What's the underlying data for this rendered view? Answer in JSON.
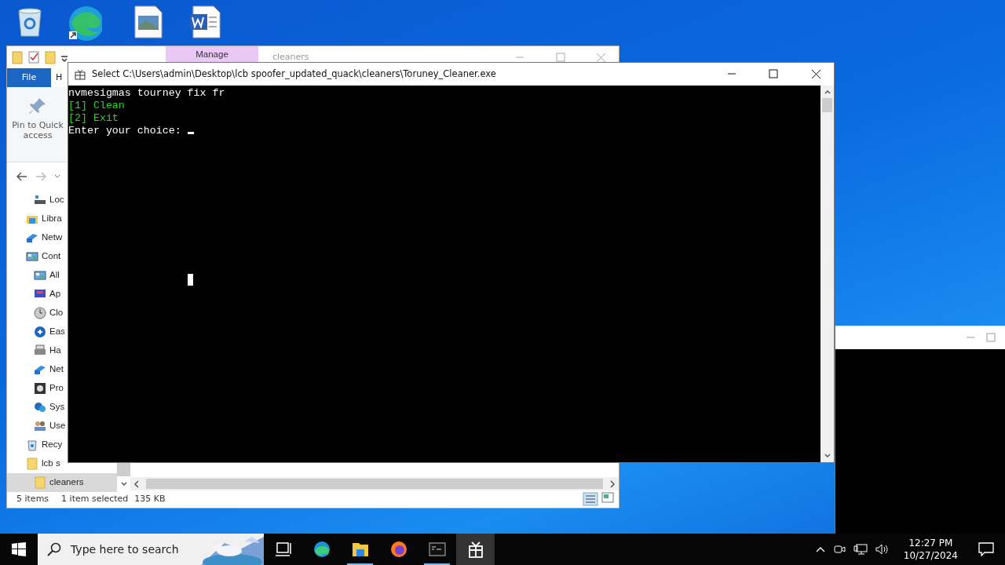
{
  "explorer": {
    "title": "cleaners",
    "context_tab": "Manage",
    "ribbon_tabs": [
      {
        "label": "File",
        "selected": true
      },
      {
        "label": "H",
        "selected": false
      }
    ],
    "pin_button": "Pin to Quick access",
    "nav_items": [
      {
        "children": [
          {
            "label": "Loc",
            "selected": false
          }
        ]
      },
      {
        "label": "Libra",
        "selected": false
      },
      {
        "label": "Netw",
        "selected": false
      },
      {
        "label": "Cont",
        "selected": false,
        "children": [
          {
            "label": "All",
            "selected": false
          },
          {
            "label": "Ap",
            "selected": false
          },
          {
            "label": "Clo",
            "selected": false
          },
          {
            "label": "Eas",
            "selected": false
          },
          {
            "label": "Ha",
            "selected": false
          },
          {
            "label": "Net",
            "selected": false
          },
          {
            "label": "Pro",
            "selected": false
          },
          {
            "label": "Sys",
            "selected": false
          },
          {
            "label": "Use",
            "selected": false
          }
        ]
      },
      {
        "label": "Recy",
        "selected": false
      },
      {
        "label": "lcb s",
        "selected": false,
        "children": [
          {
            "label": "cleaners",
            "selected": true
          }
        ]
      }
    ],
    "status": {
      "count": "5 items",
      "selection": "1 item selected",
      "size": "135 KB"
    }
  },
  "console": {
    "title": "Select C:\\Users\\admin\\Desktop\\lcb spoofer_updated_quack\\cleaners\\Toruney_Cleaner.exe",
    "lines": [
      {
        "text": "nvmesigmas tourney fix fr",
        "color": "#ffffff"
      },
      {
        "text": "[1] Clean",
        "color": "#22dd22"
      },
      {
        "text": "[2] Exit",
        "color": "#22dd22"
      },
      {
        "text": "Enter your choice: ",
        "color": "#ffffff",
        "cursor": true
      }
    ]
  },
  "taskbar": {
    "search_placeholder": "Type here to search",
    "apps": [
      {
        "kind": "taskview",
        "running": false,
        "selected": false
      },
      {
        "kind": "edge",
        "running": false,
        "selected": false
      },
      {
        "kind": "explorer",
        "running": true,
        "selected": false
      },
      {
        "kind": "firefox",
        "running": false,
        "selected": false
      },
      {
        "kind": "terminal",
        "running": true,
        "selected": false
      },
      {
        "kind": "app",
        "running": false,
        "selected": true
      }
    ],
    "time": "12:27 PM",
    "date": "10/27/2024"
  }
}
